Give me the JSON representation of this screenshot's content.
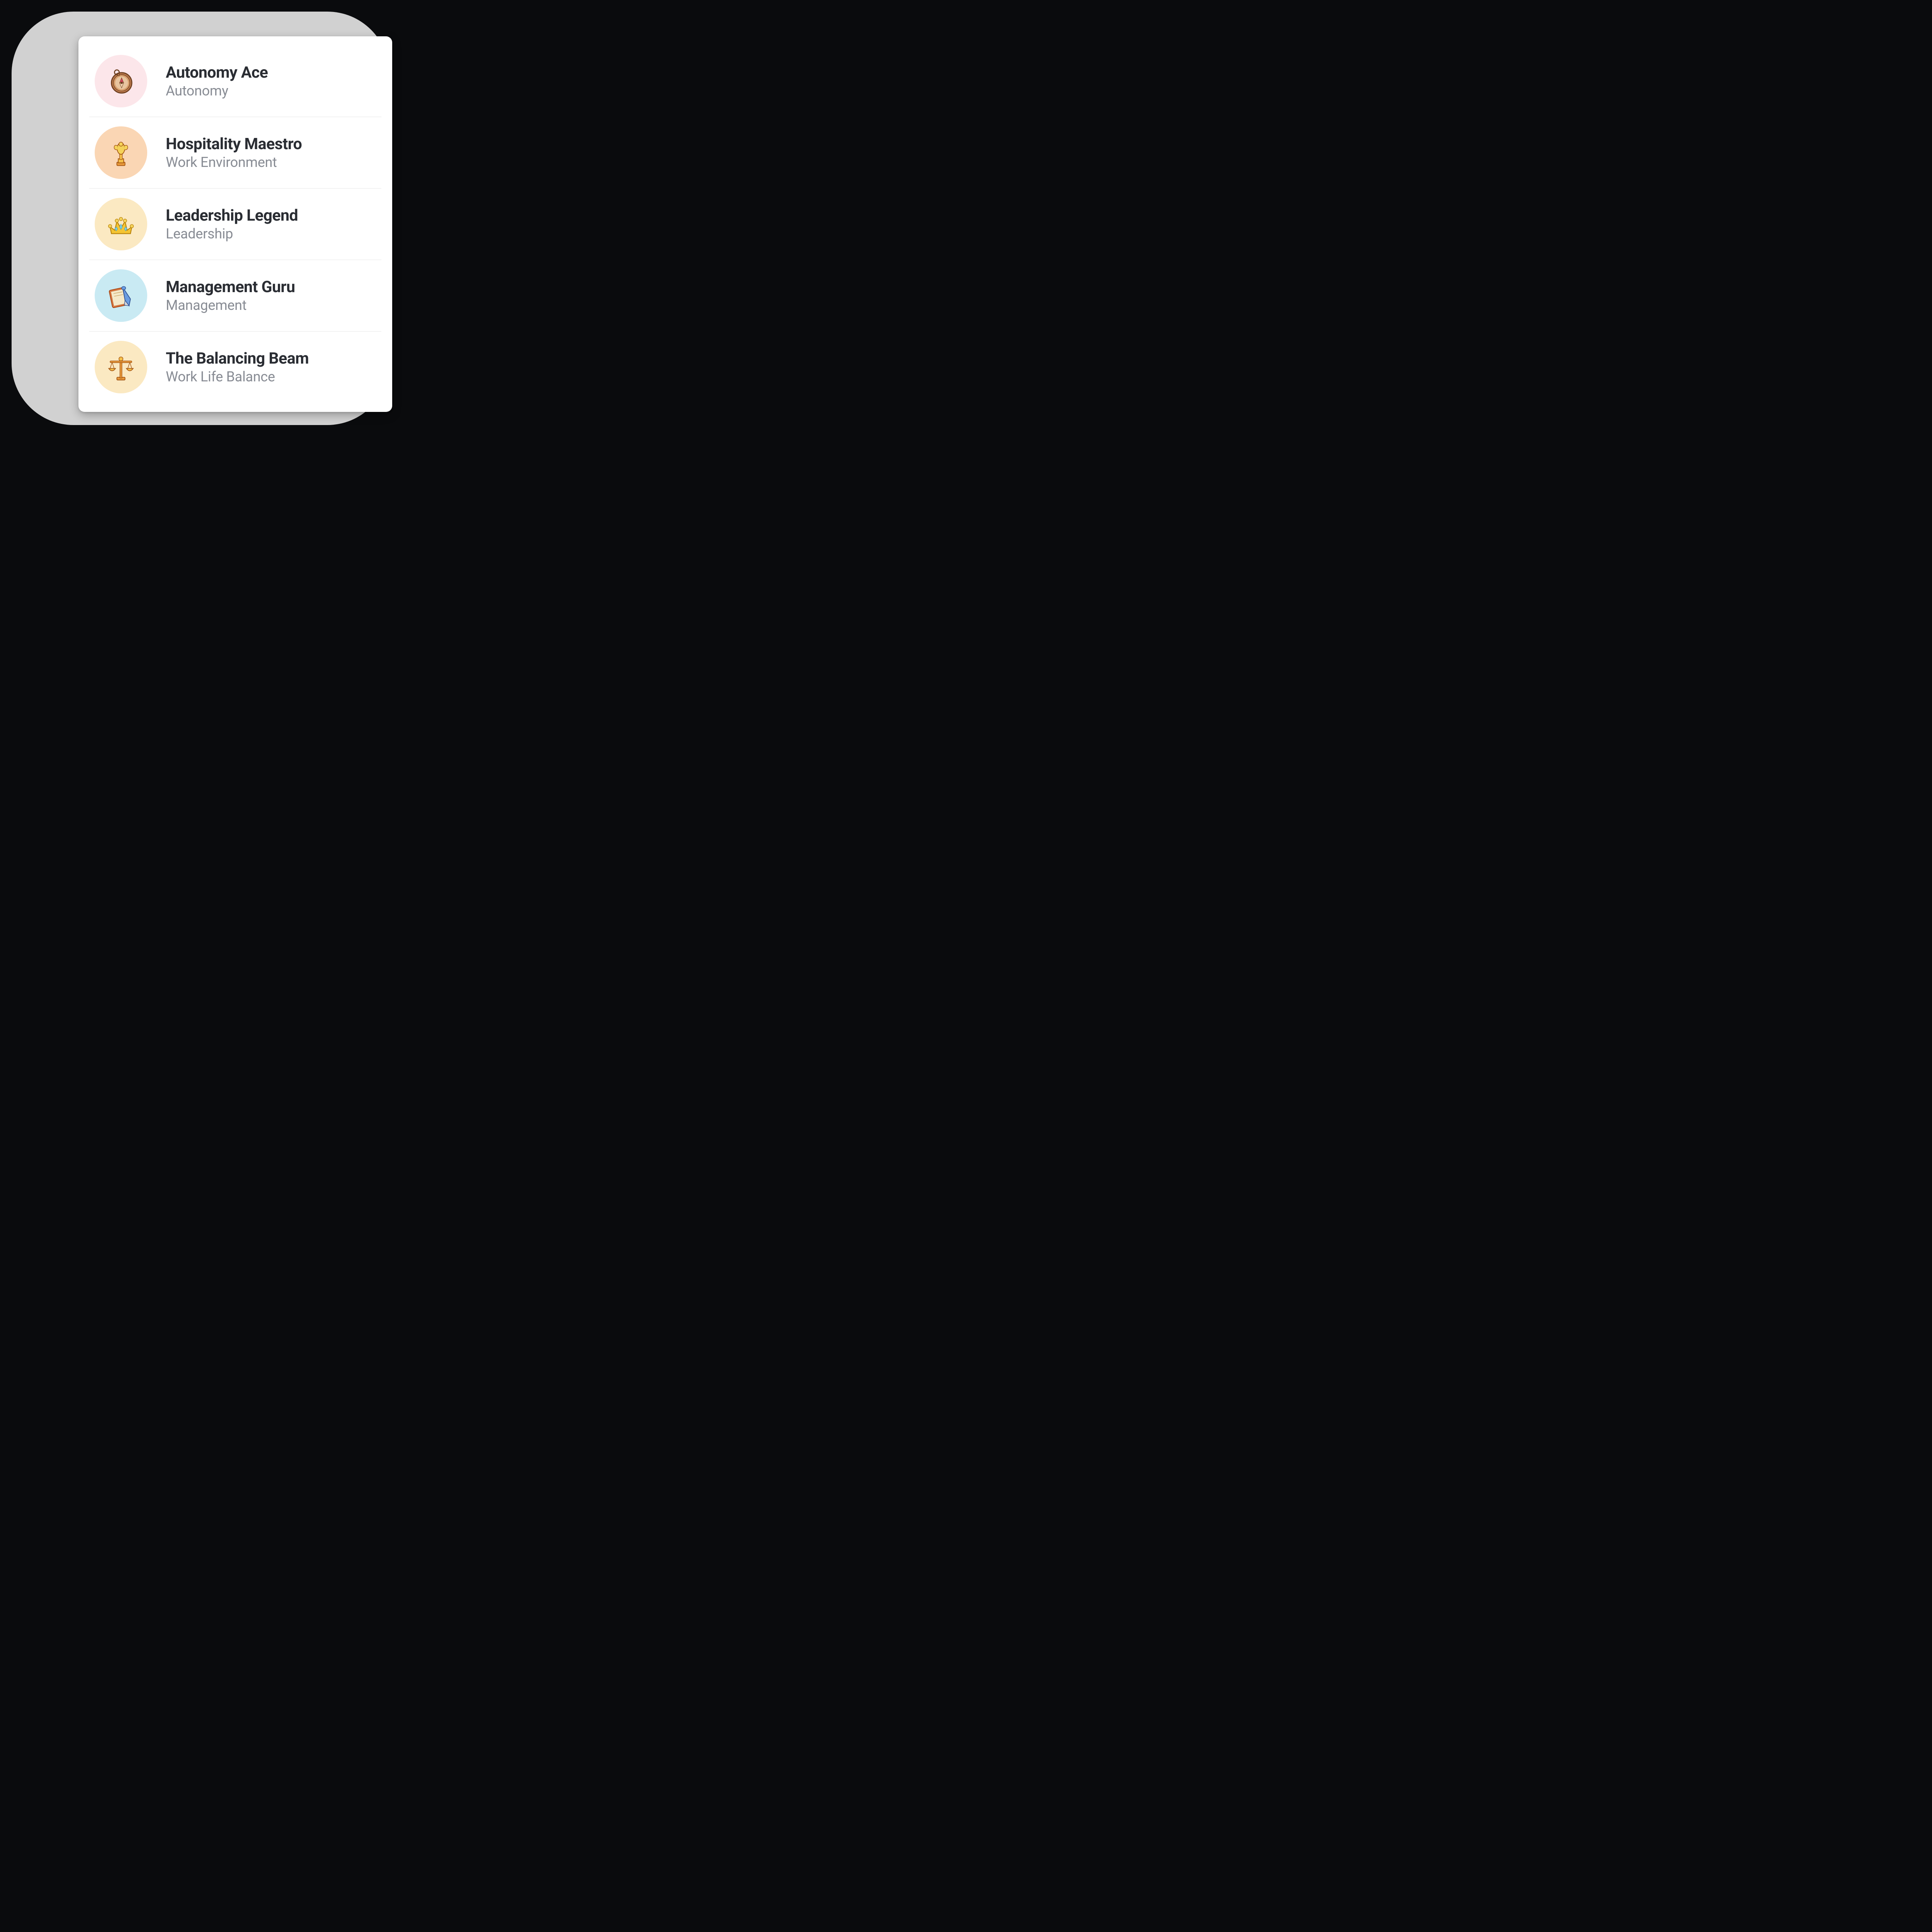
{
  "achievements": [
    {
      "title": "Autonomy Ace",
      "category": "Autonomy",
      "icon": "compass-icon",
      "bgClass": "bg-pink"
    },
    {
      "title": "Hospitality Maestro",
      "category": "Work Environment",
      "icon": "trophy-icon",
      "bgClass": "bg-orange"
    },
    {
      "title": "Leadership Legend",
      "category": "Leadership",
      "icon": "crown-icon",
      "bgClass": "bg-yellow"
    },
    {
      "title": "Management Guru",
      "category": "Management",
      "icon": "notebook-pen-icon",
      "bgClass": "bg-blue"
    },
    {
      "title": "The Balancing Beam",
      "category": "Work Life Balance",
      "icon": "scales-icon",
      "bgClass": "bg-yellow2"
    }
  ]
}
